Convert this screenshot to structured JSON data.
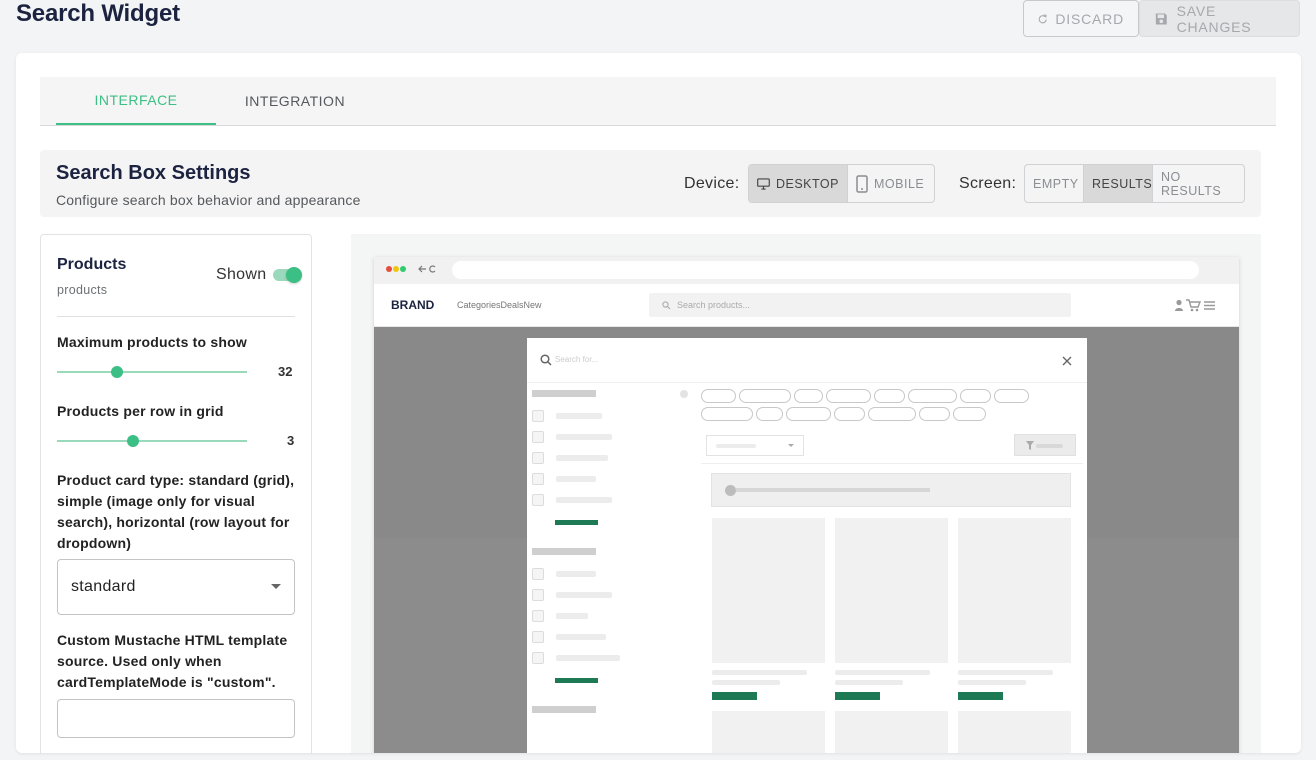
{
  "page_title": "Search Widget",
  "toolbar": {
    "discard_label": "DISCARD",
    "save_label": "SAVE CHANGES"
  },
  "tabs": [
    {
      "label": "INTERFACE",
      "active": true
    },
    {
      "label": "INTEGRATION",
      "active": false
    }
  ],
  "settings_header": {
    "title": "Search Box Settings",
    "subtitle": "Configure search box behavior and appearance",
    "device_label": "Device:",
    "device_options": [
      {
        "label": "DESKTOP",
        "icon": "monitor-icon",
        "selected": true
      },
      {
        "label": "MOBILE",
        "icon": "phone-icon",
        "selected": false
      }
    ],
    "screen_label": "Screen:",
    "screen_options": [
      {
        "label": "EMPTY",
        "selected": false
      },
      {
        "label": "RESULTS",
        "selected": true
      },
      {
        "label": "NO RESULTS",
        "selected": false
      }
    ]
  },
  "products_panel": {
    "title": "Products",
    "subtitle": "products",
    "toggle_label": "Shown",
    "toggle_on": true,
    "max_products": {
      "label": "Maximum products to show",
      "value": "32",
      "fraction": 0.32
    },
    "per_row": {
      "label": "Products per row in grid",
      "value": "3",
      "fraction": 0.4
    },
    "card_type": {
      "label": "Product card type: standard (grid), simple (image only for visual search), horizontal (row layout for dropdown)",
      "value": "standard"
    },
    "template": {
      "label": "Custom Mustache HTML template source. Used only when cardTemplateMode is \"custom\".",
      "value": ""
    }
  },
  "preview": {
    "brand": "BRAND",
    "nav_links": "CategoriesDealsNew",
    "site_search_placeholder": "Search products...",
    "modal_search_placeholder": "Search for..."
  },
  "colors": {
    "accent": "#3cbf84",
    "title": "#1c2340",
    "dark_green": "#1e7a55"
  }
}
